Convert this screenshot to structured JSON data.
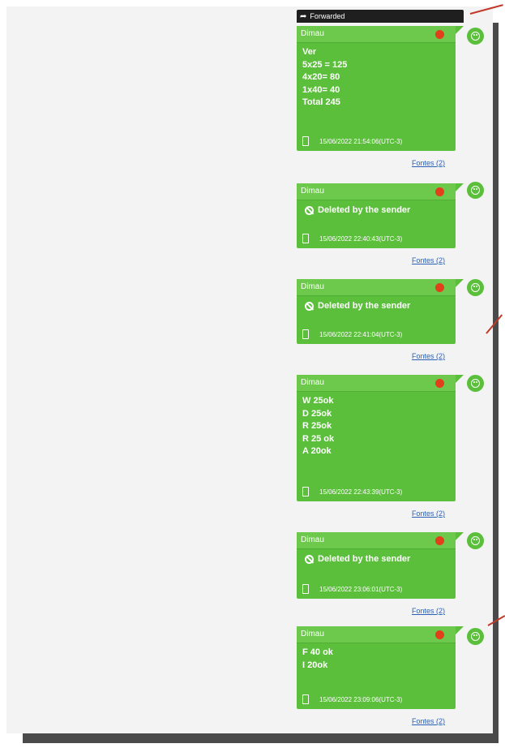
{
  "forward": {
    "label": "Forwarded"
  },
  "messages": [
    {
      "sender": "Dimau",
      "kind": "text",
      "lines": [
        "Ver",
        "5x25 = 125",
        "4x20= 80",
        "1x40= 40",
        "Total 245"
      ],
      "timestamp": "15/06/2022 21:54:06(UTC-3)",
      "sources": "Fontes (2)"
    },
    {
      "sender": "Dimau",
      "kind": "deleted",
      "text": "Deleted by the sender",
      "timestamp": "15/06/2022 22:40:43(UTC-3)",
      "sources": "Fontes (2)"
    },
    {
      "sender": "Dimau",
      "kind": "deleted",
      "text": "Deleted by the sender",
      "timestamp": "15/06/2022 22:41:04(UTC-3)",
      "sources": "Fontes (2)"
    },
    {
      "sender": "Dimau",
      "kind": "text",
      "lines": [
        "W 25ok",
        "D 25ok",
        "R 25ok",
        "R 25 ok",
        "A 20ok"
      ],
      "timestamp": "15/06/2022 22:43:39(UTC-3)",
      "sources": "Fontes (2)"
    },
    {
      "sender": "Dimau",
      "kind": "deleted",
      "text": "Deleted by the sender",
      "timestamp": "15/06/2022 23:06:01(UTC-3)",
      "sources": "Fontes (2)"
    },
    {
      "sender": "Dimau",
      "kind": "text",
      "lines": [
        "F 40 ok",
        "I 20ok"
      ],
      "timestamp": "15/06/2022 23:09:06(UTC-3)",
      "sources": "Fontes (2)"
    }
  ],
  "colors": {
    "bubble": "#5bbf3b",
    "status_dot": "#e2401c",
    "link": "#2b5fb3"
  }
}
